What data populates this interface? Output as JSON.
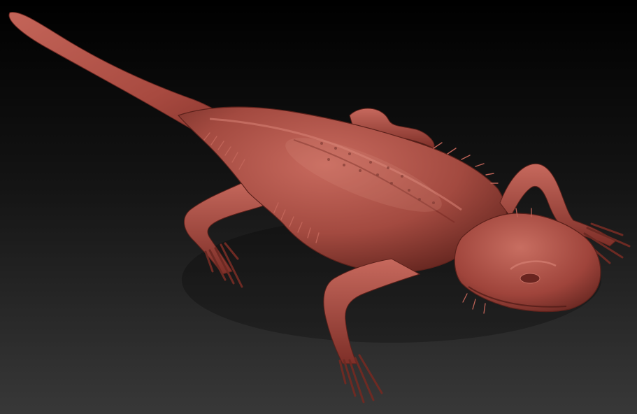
{
  "scene": {
    "subject": "lizard-sculpt",
    "background_top": "#000000",
    "background_bottom": "#383838",
    "material_base": "#a8483f",
    "material_light": "#cf7a6e",
    "material_shadow": "#3f1410",
    "material_mid": "#8e3a33"
  }
}
